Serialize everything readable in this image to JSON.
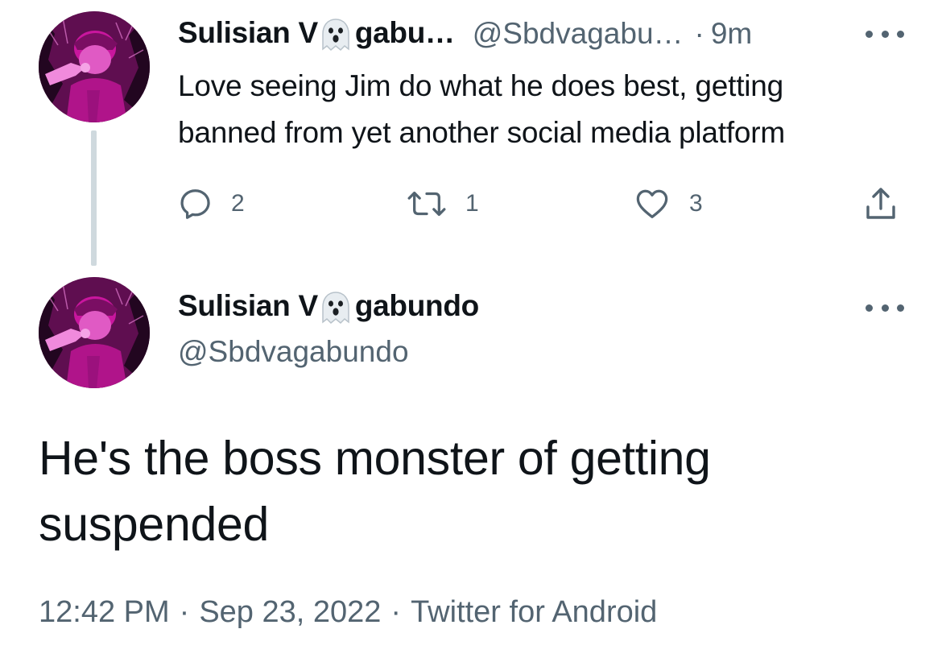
{
  "colors": {
    "text_primary": "#0f1419",
    "text_secondary": "#536471",
    "thread_line": "#cfd9de",
    "avatar_tint": "#c9169e"
  },
  "parent_tweet": {
    "avatar_icon": "profile-avatar",
    "display_name_start": "Sulisian V",
    "display_name_emoji": "ghost-emoji",
    "display_name_end": "gabu…",
    "handle": "@Sbdvagabu…",
    "separator": "·",
    "time_ago": "9m",
    "more_icon": "more-horizontal-icon",
    "text": "Love seeing Jim do what he does best, getting\nbanned from yet another social media platform",
    "actions": {
      "reply_icon": "reply-icon",
      "reply_count": "2",
      "retweet_icon": "retweet-icon",
      "retweet_count": "1",
      "like_icon": "heart-icon",
      "like_count": "3",
      "share_icon": "share-icon"
    }
  },
  "quote_tweet": {
    "avatar_icon": "profile-avatar",
    "display_name_start": "Sulisian V",
    "display_name_emoji": "ghost-emoji",
    "display_name_end": "gabundo",
    "handle": "@Sbdvagabundo",
    "more_icon": "more-horizontal-icon",
    "text": "He's the boss monster of getting\nsuspended",
    "time": "12:42 PM",
    "separator": "·",
    "date": "Sep 23, 2022",
    "source": "Twitter for Android"
  }
}
